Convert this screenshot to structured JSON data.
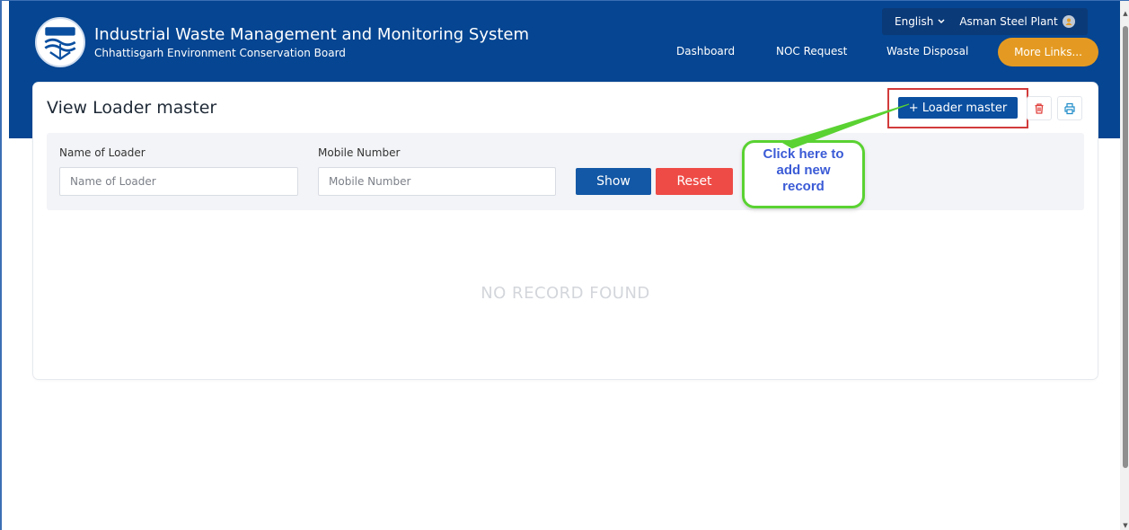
{
  "app": {
    "title": "Industrial Waste Management and Monitoring System",
    "subtitle": "Chhattisgarh Environment Conservation Board"
  },
  "util": {
    "language": "English",
    "language_icon": "chevron-down-icon",
    "user": "Asman Steel Plant",
    "user_icon": "user-icon"
  },
  "nav": {
    "items": [
      {
        "label": "Dashboard"
      },
      {
        "label": "NOC Request"
      },
      {
        "label": "Waste Disposal"
      }
    ],
    "more_label": "More Links..."
  },
  "page": {
    "title": "View Loader master",
    "add_button_label": "Loader master",
    "add_icon": "plus-icon",
    "delete_icon": "trash-icon",
    "print_icon": "printer-icon"
  },
  "filters": {
    "name_label": "Name of Loader",
    "name_placeholder": "Name of Loader",
    "name_value": "",
    "mobile_label": "Mobile Number",
    "mobile_placeholder": "Mobile Number",
    "mobile_value": "",
    "show_label": "Show",
    "reset_label": "Reset"
  },
  "results": {
    "empty_text": "NO RECORD FOUND"
  },
  "callout": {
    "lines": [
      "Click here to",
      "add new",
      "record"
    ]
  },
  "colors": {
    "header": "#054591",
    "accent": "#e49a22",
    "primary_button": "#1358a6",
    "reset_button": "#ee4b46",
    "callout_border": "#5ad232",
    "highlight_box": "#d23b3b"
  }
}
